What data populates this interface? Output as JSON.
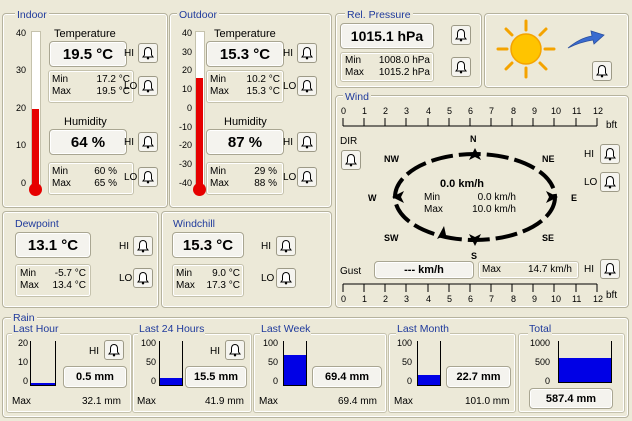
{
  "indoor": {
    "title": "Indoor",
    "scale": [
      "40",
      "30",
      "20",
      "10",
      "0"
    ],
    "temp_label": "Temperature",
    "temp_value": "19.5 °C",
    "temp_min_label": "Min",
    "temp_min": "17.2 °C",
    "temp_max_label": "Max",
    "temp_max": "19.5 °C",
    "hum_label": "Humidity",
    "hum_value": "64 %",
    "hum_min_label": "Min",
    "hum_min": "60 %",
    "hum_max_label": "Max",
    "hum_max": "65 %",
    "hi": "HI",
    "lo": "LO",
    "thermo_level": 0.49
  },
  "outdoor": {
    "title": "Outdoor",
    "scale": [
      "40",
      "30",
      "20",
      "10",
      "0",
      "-10",
      "-20",
      "-30",
      "-40"
    ],
    "temp_label": "Temperature",
    "temp_value": "15.3 °C",
    "temp_min_label": "Min",
    "temp_min": "10.2 °C",
    "temp_max_label": "Max",
    "temp_max": "15.3 °C",
    "hum_label": "Humidity",
    "hum_value": "87 %",
    "hum_min_label": "Min",
    "hum_min": "29 %",
    "hum_max_label": "Max",
    "hum_max": "88 %",
    "hi": "HI",
    "lo": "LO",
    "thermo_level": 0.69
  },
  "pressure": {
    "title": "Rel. Pressure",
    "value": "1015.1 hPa",
    "min_label": "Min",
    "min": "1008.0 hPa",
    "max_label": "Max",
    "max": "1015.2 hPa"
  },
  "forecast": {
    "icon": "sun-icon",
    "trend_icon": "rising-arrow-icon"
  },
  "dewpoint": {
    "title": "Dewpoint",
    "value": "13.1 °C",
    "min_label": "Min",
    "min": "-5.7 °C",
    "max_label": "Max",
    "max": "13.4 °C",
    "hi": "HI",
    "lo": "LO"
  },
  "windchill": {
    "title": "Windchill",
    "value": "15.3 °C",
    "min_label": "Min",
    "min": "9.0 °C",
    "max_label": "Max",
    "max": "17.3 °C",
    "hi": "HI",
    "lo": "LO"
  },
  "wind": {
    "title": "Wind",
    "scale": [
      "0",
      "1",
      "2",
      "3",
      "4",
      "5",
      "6",
      "7",
      "8",
      "9",
      "10",
      "11",
      "12"
    ],
    "unit": "bft",
    "dir_label": "DIR",
    "hi": "HI",
    "lo": "LO",
    "compass": [
      "N",
      "NE",
      "E",
      "SE",
      "S",
      "SW",
      "W",
      "NW"
    ],
    "speed": "0.0 km/h",
    "min_label": "Min",
    "min": "0.0 km/h",
    "max_label": "Max",
    "max": "10.0 km/h",
    "gust_label": "Gust",
    "gust_value": "--- km/h",
    "gust_max_label": "Max",
    "gust_max": "14.7 km/h"
  },
  "rain": {
    "title": "Rain",
    "blocks": [
      {
        "title": "Last Hour",
        "scale": [
          "20",
          "10",
          "0"
        ],
        "value": "0.5 mm",
        "max_label": "Max",
        "max": "32.1 mm",
        "level": 0.03,
        "hi": "HI"
      },
      {
        "title": "Last 24 Hours",
        "scale": [
          "100",
          "50",
          "0"
        ],
        "value": "15.5 mm",
        "max_label": "Max",
        "max": "41.9 mm",
        "level": 0.16,
        "hi": "HI"
      },
      {
        "title": "Last Week",
        "scale": [
          "100",
          "50",
          "0"
        ],
        "value": "69.4 mm",
        "max_label": "Max",
        "max": "69.4 mm",
        "level": 0.69
      },
      {
        "title": "Last Month",
        "scale": [
          "100",
          "50",
          "0"
        ],
        "value": "22.7 mm",
        "max_label": "Max",
        "max": "101.0 mm",
        "level": 0.23
      },
      {
        "title": "Total",
        "scale": [
          "1000",
          "500",
          "0"
        ],
        "value": "587.4 mm",
        "level": 0.59
      }
    ]
  }
}
